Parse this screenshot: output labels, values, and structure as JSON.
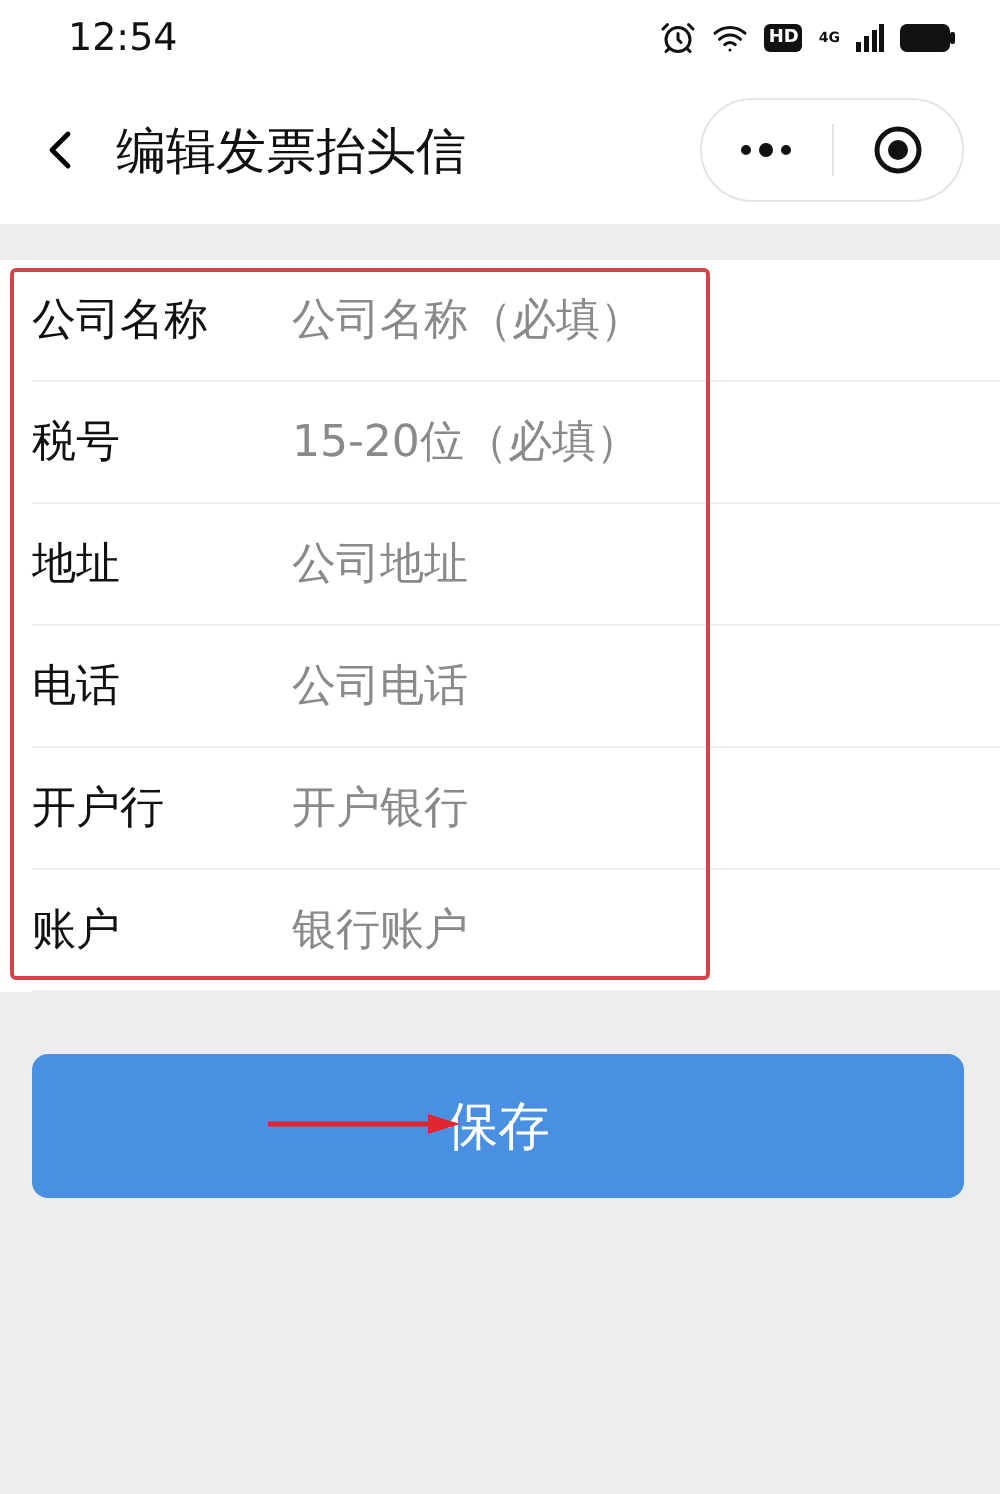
{
  "status_bar": {
    "time": "12:54",
    "hd_label": "HD",
    "network_label": "4G"
  },
  "nav": {
    "title": "编辑发票抬头信"
  },
  "form": {
    "rows": [
      {
        "label": "公司名称",
        "placeholder": "公司名称（必填）"
      },
      {
        "label": "税号",
        "placeholder": "15-20位（必填）"
      },
      {
        "label": "地址",
        "placeholder": "公司地址"
      },
      {
        "label": "电话",
        "placeholder": "公司电话"
      },
      {
        "label": "开户行",
        "placeholder": "开户银行"
      },
      {
        "label": "账户",
        "placeholder": "银行账户"
      }
    ]
  },
  "save_button": {
    "label": "保存"
  }
}
